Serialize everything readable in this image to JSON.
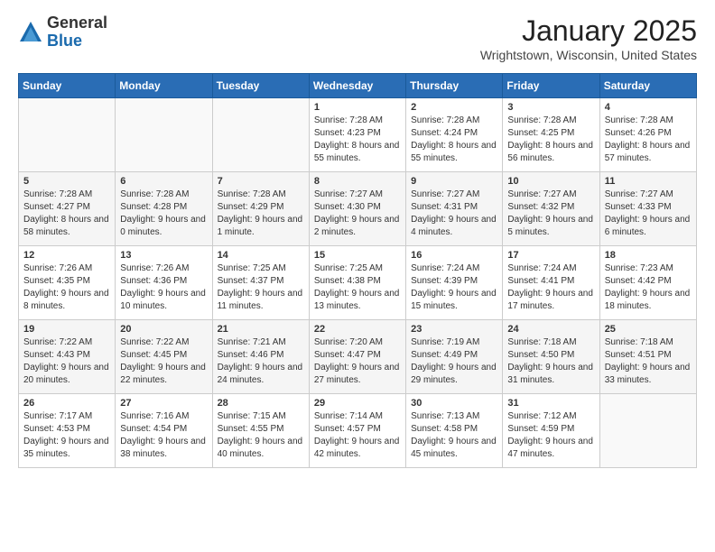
{
  "logo": {
    "general": "General",
    "blue": "Blue"
  },
  "title": "January 2025",
  "location": "Wrightstown, Wisconsin, United States",
  "days_header": [
    "Sunday",
    "Monday",
    "Tuesday",
    "Wednesday",
    "Thursday",
    "Friday",
    "Saturday"
  ],
  "weeks": [
    [
      {
        "day": "",
        "sunrise": "",
        "sunset": "",
        "daylight": ""
      },
      {
        "day": "",
        "sunrise": "",
        "sunset": "",
        "daylight": ""
      },
      {
        "day": "",
        "sunrise": "",
        "sunset": "",
        "daylight": ""
      },
      {
        "day": "1",
        "sunrise": "Sunrise: 7:28 AM",
        "sunset": "Sunset: 4:23 PM",
        "daylight": "Daylight: 8 hours and 55 minutes."
      },
      {
        "day": "2",
        "sunrise": "Sunrise: 7:28 AM",
        "sunset": "Sunset: 4:24 PM",
        "daylight": "Daylight: 8 hours and 55 minutes."
      },
      {
        "day": "3",
        "sunrise": "Sunrise: 7:28 AM",
        "sunset": "Sunset: 4:25 PM",
        "daylight": "Daylight: 8 hours and 56 minutes."
      },
      {
        "day": "4",
        "sunrise": "Sunrise: 7:28 AM",
        "sunset": "Sunset: 4:26 PM",
        "daylight": "Daylight: 8 hours and 57 minutes."
      }
    ],
    [
      {
        "day": "5",
        "sunrise": "Sunrise: 7:28 AM",
        "sunset": "Sunset: 4:27 PM",
        "daylight": "Daylight: 8 hours and 58 minutes."
      },
      {
        "day": "6",
        "sunrise": "Sunrise: 7:28 AM",
        "sunset": "Sunset: 4:28 PM",
        "daylight": "Daylight: 9 hours and 0 minutes."
      },
      {
        "day": "7",
        "sunrise": "Sunrise: 7:28 AM",
        "sunset": "Sunset: 4:29 PM",
        "daylight": "Daylight: 9 hours and 1 minute."
      },
      {
        "day": "8",
        "sunrise": "Sunrise: 7:27 AM",
        "sunset": "Sunset: 4:30 PM",
        "daylight": "Daylight: 9 hours and 2 minutes."
      },
      {
        "day": "9",
        "sunrise": "Sunrise: 7:27 AM",
        "sunset": "Sunset: 4:31 PM",
        "daylight": "Daylight: 9 hours and 4 minutes."
      },
      {
        "day": "10",
        "sunrise": "Sunrise: 7:27 AM",
        "sunset": "Sunset: 4:32 PM",
        "daylight": "Daylight: 9 hours and 5 minutes."
      },
      {
        "day": "11",
        "sunrise": "Sunrise: 7:27 AM",
        "sunset": "Sunset: 4:33 PM",
        "daylight": "Daylight: 9 hours and 6 minutes."
      }
    ],
    [
      {
        "day": "12",
        "sunrise": "Sunrise: 7:26 AM",
        "sunset": "Sunset: 4:35 PM",
        "daylight": "Daylight: 9 hours and 8 minutes."
      },
      {
        "day": "13",
        "sunrise": "Sunrise: 7:26 AM",
        "sunset": "Sunset: 4:36 PM",
        "daylight": "Daylight: 9 hours and 10 minutes."
      },
      {
        "day": "14",
        "sunrise": "Sunrise: 7:25 AM",
        "sunset": "Sunset: 4:37 PM",
        "daylight": "Daylight: 9 hours and 11 minutes."
      },
      {
        "day": "15",
        "sunrise": "Sunrise: 7:25 AM",
        "sunset": "Sunset: 4:38 PM",
        "daylight": "Daylight: 9 hours and 13 minutes."
      },
      {
        "day": "16",
        "sunrise": "Sunrise: 7:24 AM",
        "sunset": "Sunset: 4:39 PM",
        "daylight": "Daylight: 9 hours and 15 minutes."
      },
      {
        "day": "17",
        "sunrise": "Sunrise: 7:24 AM",
        "sunset": "Sunset: 4:41 PM",
        "daylight": "Daylight: 9 hours and 17 minutes."
      },
      {
        "day": "18",
        "sunrise": "Sunrise: 7:23 AM",
        "sunset": "Sunset: 4:42 PM",
        "daylight": "Daylight: 9 hours and 18 minutes."
      }
    ],
    [
      {
        "day": "19",
        "sunrise": "Sunrise: 7:22 AM",
        "sunset": "Sunset: 4:43 PM",
        "daylight": "Daylight: 9 hours and 20 minutes."
      },
      {
        "day": "20",
        "sunrise": "Sunrise: 7:22 AM",
        "sunset": "Sunset: 4:45 PM",
        "daylight": "Daylight: 9 hours and 22 minutes."
      },
      {
        "day": "21",
        "sunrise": "Sunrise: 7:21 AM",
        "sunset": "Sunset: 4:46 PM",
        "daylight": "Daylight: 9 hours and 24 minutes."
      },
      {
        "day": "22",
        "sunrise": "Sunrise: 7:20 AM",
        "sunset": "Sunset: 4:47 PM",
        "daylight": "Daylight: 9 hours and 27 minutes."
      },
      {
        "day": "23",
        "sunrise": "Sunrise: 7:19 AM",
        "sunset": "Sunset: 4:49 PM",
        "daylight": "Daylight: 9 hours and 29 minutes."
      },
      {
        "day": "24",
        "sunrise": "Sunrise: 7:18 AM",
        "sunset": "Sunset: 4:50 PM",
        "daylight": "Daylight: 9 hours and 31 minutes."
      },
      {
        "day": "25",
        "sunrise": "Sunrise: 7:18 AM",
        "sunset": "Sunset: 4:51 PM",
        "daylight": "Daylight: 9 hours and 33 minutes."
      }
    ],
    [
      {
        "day": "26",
        "sunrise": "Sunrise: 7:17 AM",
        "sunset": "Sunset: 4:53 PM",
        "daylight": "Daylight: 9 hours and 35 minutes."
      },
      {
        "day": "27",
        "sunrise": "Sunrise: 7:16 AM",
        "sunset": "Sunset: 4:54 PM",
        "daylight": "Daylight: 9 hours and 38 minutes."
      },
      {
        "day": "28",
        "sunrise": "Sunrise: 7:15 AM",
        "sunset": "Sunset: 4:55 PM",
        "daylight": "Daylight: 9 hours and 40 minutes."
      },
      {
        "day": "29",
        "sunrise": "Sunrise: 7:14 AM",
        "sunset": "Sunset: 4:57 PM",
        "daylight": "Daylight: 9 hours and 42 minutes."
      },
      {
        "day": "30",
        "sunrise": "Sunrise: 7:13 AM",
        "sunset": "Sunset: 4:58 PM",
        "daylight": "Daylight: 9 hours and 45 minutes."
      },
      {
        "day": "31",
        "sunrise": "Sunrise: 7:12 AM",
        "sunset": "Sunset: 4:59 PM",
        "daylight": "Daylight: 9 hours and 47 minutes."
      },
      {
        "day": "",
        "sunrise": "",
        "sunset": "",
        "daylight": ""
      }
    ]
  ]
}
